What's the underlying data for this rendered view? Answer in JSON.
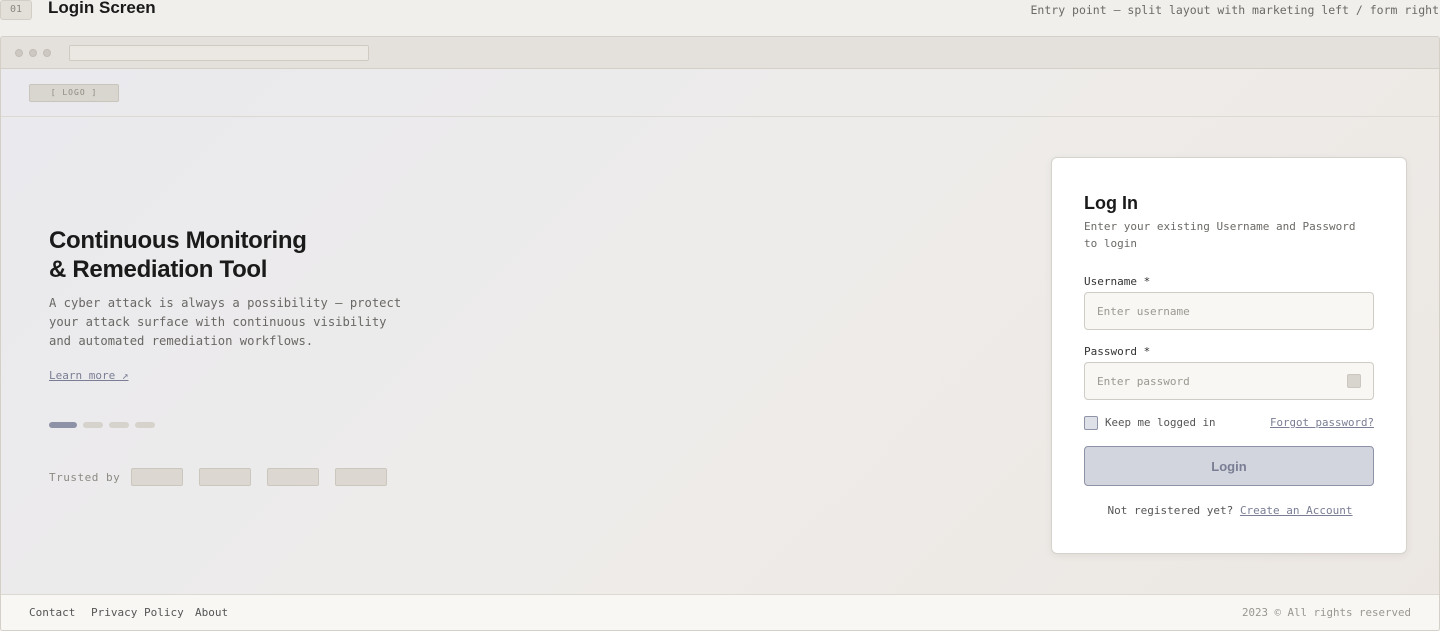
{
  "doc": {
    "number": "01",
    "title": "Login Screen",
    "description": "Entry point — split layout with marketing left / form right"
  },
  "header": {
    "logo": "[ LOGO ]"
  },
  "hero": {
    "title_line1": "Continuous Monitoring",
    "title_line2": "& Remediation Tool",
    "description": "A cyber attack is always a possibility — protect your attack surface with continuous visibility and automated remediation workflows.",
    "learn_more": "Learn more ↗",
    "carousel_active_index": 0,
    "carousel_count": 4,
    "trusted_label": "Trusted by"
  },
  "login": {
    "title": "Log In",
    "subtitle": "Enter your existing Username and Password to login",
    "username_label": "Username *",
    "username_placeholder": "Enter username",
    "password_label": "Password *",
    "password_placeholder": "Enter password",
    "keep_logged_in": "Keep me logged in",
    "forgot_password": "Forgot password?",
    "login_button": "Login",
    "not_registered": "Not registered yet?",
    "create_account": "Create an Account"
  },
  "footer": {
    "links": [
      "Contact",
      "Privacy Policy",
      "About"
    ],
    "copyright": "2023 © All rights reserved"
  },
  "colors": {
    "accent": "#7a7e94",
    "carousel_active": "#8e92a6",
    "button_bg": "#d2d4de"
  }
}
